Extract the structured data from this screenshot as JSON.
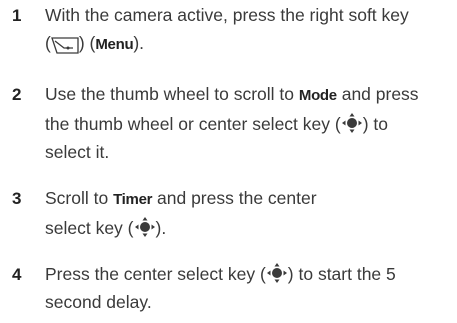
{
  "steps": [
    {
      "number": "1",
      "lines": [
        {
          "before": "With the camera active, press the right soft key"
        },
        {
          "open": "(",
          "close": ")",
          "paren_open": "(",
          "keyword": "Menu",
          "paren_close": ")."
        }
      ]
    },
    {
      "number": "2",
      "lines": [
        {
          "before": "Use the thumb wheel to scroll to ",
          "keyword": "Mode",
          "after": " and press"
        },
        {
          "before": "the thumb wheel or center select key (",
          "after": ") to"
        },
        {
          "before": "select it."
        }
      ]
    },
    {
      "number": "3",
      "lines": [
        {
          "before": "Scroll to ",
          "keyword": "Timer",
          "after": " and press the center"
        },
        {
          "before": "select key (",
          "after": ")."
        }
      ]
    },
    {
      "number": "4",
      "lines": [
        {
          "before": "Press the center select key (",
          "after": ") to start the 5"
        },
        {
          "before": "second delay."
        }
      ]
    }
  ],
  "icons": {
    "soft_key": "right-soft-key-icon",
    "nav_key": "center-select-key-icon"
  },
  "colors": {
    "text": "#3a3a3a",
    "number": "#222222"
  }
}
